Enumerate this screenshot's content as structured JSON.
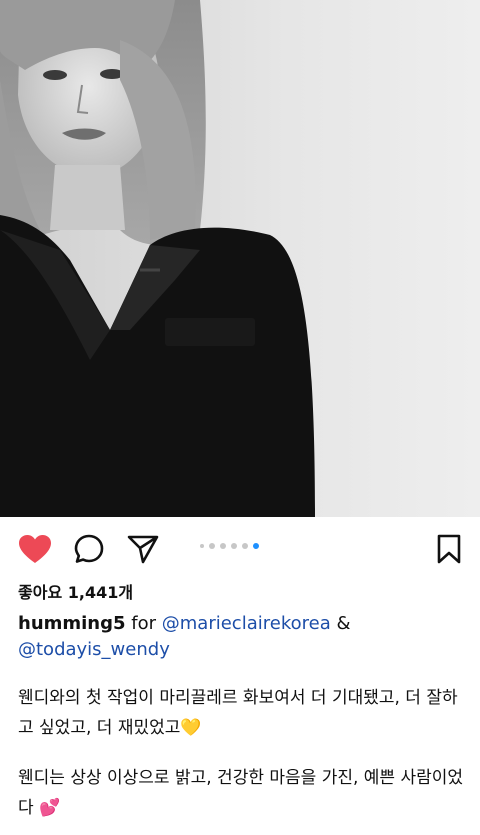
{
  "post": {
    "likes_text": "좋아요 1,441개",
    "author": "humming5",
    "for_word": "for",
    "mention_1": "@marieclairekorea",
    "ampersand": "&",
    "mention_2": "@todayis_wendy",
    "paragraph_1": "웬디와의 첫 작업이 마리끌레르 화보여서 더 기대됐고, 더 잘하고 싶었고, 더 재밌었고💛",
    "paragraph_2": "웬디는 상상 이상으로 밝고, 건강한 마음을 가진, 예쁜 사람이었다 💕"
  },
  "carousel": {
    "count": 6,
    "active_index": 5
  },
  "icons": {
    "like": "heart-icon-filled",
    "comment": "comment-bubble-icon",
    "share": "send-paper-plane-icon",
    "save": "bookmark-icon"
  },
  "colors": {
    "like": "#ed4956",
    "active_dot": "#1e90ff",
    "mention": "#1d4ea8"
  }
}
